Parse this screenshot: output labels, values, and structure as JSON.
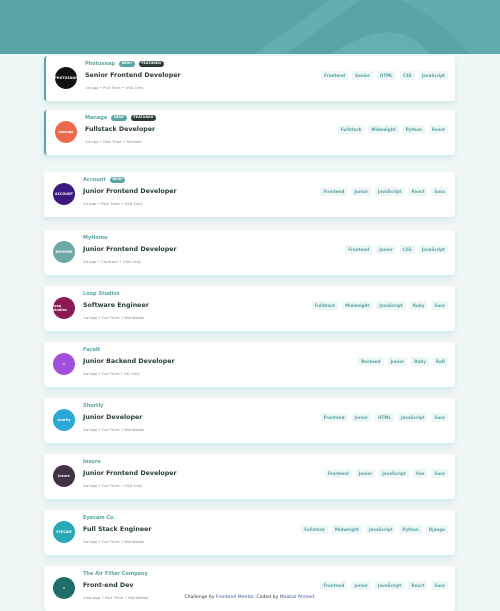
{
  "jobs": [
    {
      "company": "Photosnap",
      "logo_text": "PHOTOSNAP",
      "logo_color": "#111111",
      "new": true,
      "featured": true,
      "position": "Senior Frontend Developer",
      "posted": "1d ago",
      "contract": "Full Time",
      "location": "USA Only",
      "tags": [
        "Frontend",
        "Senior",
        "HTML",
        "CSS",
        "JavaScript"
      ]
    },
    {
      "company": "Manage",
      "logo_text": "manage",
      "logo_color": "#ec6a4a",
      "new": true,
      "featured": true,
      "position": "Fullstack Developer",
      "posted": "1d ago",
      "contract": "Part Time",
      "location": "Remote",
      "tags": [
        "Fullstack",
        "Midweight",
        "Python",
        "React"
      ]
    },
    {
      "company": "Account",
      "logo_text": "ACCOUNT",
      "logo_color": "#3b1780",
      "new": true,
      "featured": false,
      "position": "Junior Frontend Developer",
      "posted": "2d ago",
      "contract": "Part Time",
      "location": "USA Only",
      "tags": [
        "Frontend",
        "Junior",
        "JavaScript",
        "React",
        "Sass"
      ]
    },
    {
      "company": "MyHome",
      "logo_text": "MYHOME",
      "logo_color": "#6ea9a5",
      "new": false,
      "featured": false,
      "position": "Junior Frontend Developer",
      "posted": "5d ago",
      "contract": "Contract",
      "location": "USA Only",
      "tags": [
        "Frontend",
        "Junior",
        "CSS",
        "JavaScript"
      ]
    },
    {
      "company": "Loop Studios",
      "logo_text": "loop studios",
      "logo_color": "#8a1b54",
      "new": false,
      "featured": false,
      "position": "Software Engineer",
      "posted": "1w ago",
      "contract": "Full Time",
      "location": "Worldwide",
      "tags": [
        "Fullstack",
        "Midweight",
        "JavaScript",
        "Ruby",
        "Sass"
      ]
    },
    {
      "company": "FaceIt",
      "logo_text": "◎",
      "logo_color": "#a24fdc",
      "new": false,
      "featured": false,
      "position": "Junior Backend Developer",
      "posted": "2w ago",
      "contract": "Full Time",
      "location": "UK Only",
      "tags": [
        "Backend",
        "Junior",
        "Ruby",
        "RoR"
      ]
    },
    {
      "company": "Shortly",
      "logo_text": "shortly",
      "logo_color": "#2aa9d9",
      "new": false,
      "featured": false,
      "position": "Junior Developer",
      "posted": "2w ago",
      "contract": "Full Time",
      "location": "Worldwide",
      "tags": [
        "Frontend",
        "Junior",
        "HTML",
        "JavaScript",
        "Sass"
      ]
    },
    {
      "company": "Insure",
      "logo_text": "insure",
      "logo_color": "#3e3444",
      "new": false,
      "featured": false,
      "position": "Junior Frontend Developer",
      "posted": "2w ago",
      "contract": "Full Time",
      "location": "USA Only",
      "tags": [
        "Frontend",
        "Junior",
        "JavaScript",
        "Vue",
        "Sass"
      ]
    },
    {
      "company": "Eyecam Co.",
      "logo_text": "EYECAM",
      "logo_color": "#29a9b8",
      "new": false,
      "featured": false,
      "position": "Full Stack Engineer",
      "posted": "3w ago",
      "contract": "Full Time",
      "location": "Worldwide",
      "tags": [
        "Fullstack",
        "Midweight",
        "JavaScript",
        "Python",
        "Django"
      ]
    },
    {
      "company": "The Air Filter Company",
      "logo_text": "∞",
      "logo_color": "#1e6f6a",
      "new": false,
      "featured": false,
      "position": "Front-end Dev",
      "posted": "1mo ago",
      "contract": "Part Time",
      "location": "Worldwide",
      "tags": [
        "Frontend",
        "Junior",
        "JavaScript",
        "React",
        "Sass"
      ]
    }
  ],
  "labels": {
    "new": "NEW!",
    "featured": "FEATURED"
  },
  "footer": {
    "prefix": "Challenge by ",
    "link1": "Frontend Mentor",
    "middle": ". Coded by ",
    "link2": "Moataz Ahmed",
    "suffix": "."
  }
}
